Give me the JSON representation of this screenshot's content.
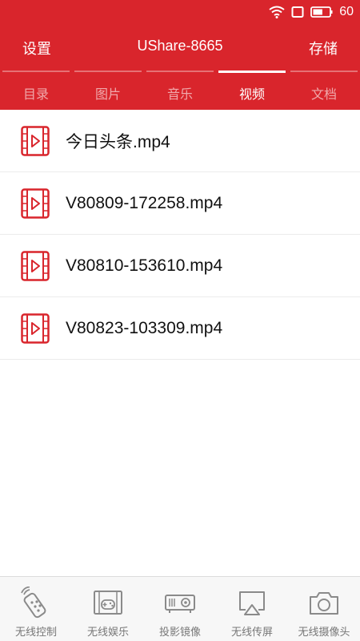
{
  "status_bar": {
    "wifi_icon": "wifi-icon",
    "sim_icon": "sim-icon",
    "battery_icon": "battery-icon",
    "battery_level": "60"
  },
  "app_bar": {
    "left_label": "设置",
    "title": "UShare-8665",
    "right_label": "存储"
  },
  "tabs": [
    {
      "label": "目录",
      "active": false
    },
    {
      "label": "图片",
      "active": false
    },
    {
      "label": "音乐",
      "active": false
    },
    {
      "label": "视频",
      "active": true
    },
    {
      "label": "文档",
      "active": false
    }
  ],
  "files": [
    {
      "name": "今日头条.mp4",
      "icon": "video-file-icon"
    },
    {
      "name": "V80809-172258.mp4",
      "icon": "video-file-icon"
    },
    {
      "name": "V80810-153610.mp4",
      "icon": "video-file-icon"
    },
    {
      "name": "V80823-103309.mp4",
      "icon": "video-file-icon"
    }
  ],
  "bottom_nav": [
    {
      "label": "无线控制",
      "icon": "remote-control-icon"
    },
    {
      "label": "无线娱乐",
      "icon": "gamepad-icon"
    },
    {
      "label": "投影镜像",
      "icon": "projector-icon"
    },
    {
      "label": "无线传屏",
      "icon": "screen-cast-icon"
    },
    {
      "label": "无线摄像头",
      "icon": "camera-icon"
    }
  ],
  "colors": {
    "brand_red": "#d9252c",
    "icon_gray": "#8a8a8a"
  }
}
